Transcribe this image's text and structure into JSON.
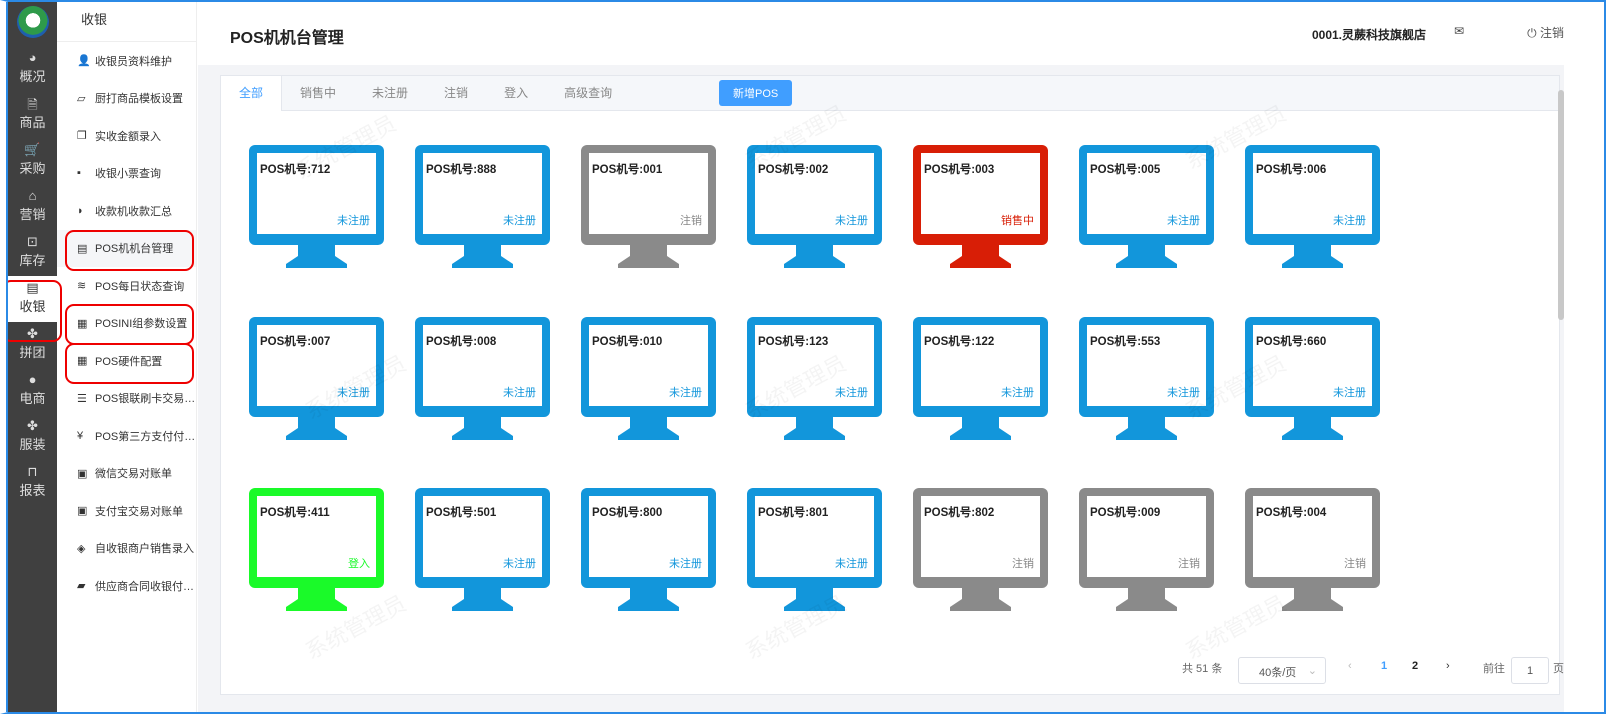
{
  "nav": [
    {
      "label": "概况",
      "icon": "dashboard-icon"
    },
    {
      "label": "商品",
      "icon": "document-icon"
    },
    {
      "label": "采购",
      "icon": "cart-icon"
    },
    {
      "label": "营销",
      "icon": "tag-icon"
    },
    {
      "label": "库存",
      "icon": "box-icon"
    },
    {
      "label": "收银",
      "icon": "cash-register-icon",
      "active": true
    },
    {
      "label": "拼团",
      "icon": "clover-icon"
    },
    {
      "label": "电商",
      "icon": "user-icon"
    },
    {
      "label": "服装",
      "icon": "clover-icon"
    },
    {
      "label": "报表",
      "icon": "report-icon"
    }
  ],
  "submenu": {
    "title": "收银",
    "items": [
      {
        "label": "收银员资料维护"
      },
      {
        "label": "厨打商品模板设置"
      },
      {
        "label": "实收金额录入"
      },
      {
        "label": "收银小票查询"
      },
      {
        "label": "收款机收款汇总"
      },
      {
        "label": "POS机机台管理",
        "active": true
      },
      {
        "label": "POS每日状态查询"
      },
      {
        "label": "POSINI组参数设置"
      },
      {
        "label": "POS硬件配置"
      },
      {
        "label": "POS银联刷卡交易…"
      },
      {
        "label": "POS第三方支付付…"
      },
      {
        "label": "微信交易对账单"
      },
      {
        "label": "支付宝交易对账单"
      },
      {
        "label": "自收银商户销售录入"
      },
      {
        "label": "供应商合同收银付…"
      }
    ]
  },
  "header": {
    "title": "POS机机台管理",
    "store": "0001.灵蕨科技旗舰店",
    "logout": "注销"
  },
  "tabs": [
    "全部",
    "销售中",
    "未注册",
    "注销",
    "登入",
    "高级查询"
  ],
  "new_button": "新增POS",
  "watermark": "系统管理员",
  "status_colors": {
    "未注册": "#1296db",
    "注销": "#8a8a8a",
    "销售中": "#d81e06",
    "登入": "#1afa29"
  },
  "status_text_colors": {
    "未注册": "#1296db",
    "注销": "#888888",
    "销售中": "#d81e06",
    "登入": "#1afa29"
  },
  "pos_list": [
    {
      "name": "POS机号:712",
      "status": "未注册"
    },
    {
      "name": "POS机号:888",
      "status": "未注册"
    },
    {
      "name": "POS机号:001",
      "status": "注销"
    },
    {
      "name": "POS机号:002",
      "status": "未注册"
    },
    {
      "name": "POS机号:003",
      "status": "销售中"
    },
    {
      "name": "POS机号:005",
      "status": "未注册"
    },
    {
      "name": "POS机号:006",
      "status": "未注册"
    },
    {
      "name": "POS机号:007",
      "status": "未注册"
    },
    {
      "name": "POS机号:008",
      "status": "未注册"
    },
    {
      "name": "POS机号:010",
      "status": "未注册"
    },
    {
      "name": "POS机号:123",
      "status": "未注册"
    },
    {
      "name": "POS机号:122",
      "status": "未注册"
    },
    {
      "name": "POS机号:553",
      "status": "未注册"
    },
    {
      "name": "POS机号:660",
      "status": "未注册"
    },
    {
      "name": "POS机号:411",
      "status": "登入"
    },
    {
      "name": "POS机号:501",
      "status": "未注册"
    },
    {
      "name": "POS机号:800",
      "status": "未注册"
    },
    {
      "name": "POS机号:801",
      "status": "未注册"
    },
    {
      "name": "POS机号:802",
      "status": "注销"
    },
    {
      "name": "POS机号:009",
      "status": "注销"
    },
    {
      "name": "POS机号:004",
      "status": "注销"
    }
  ],
  "pagination": {
    "total": "共 51 条",
    "page_size": "40条/页",
    "pages": [
      "1",
      "2"
    ],
    "current": "1",
    "goto_label": "前往",
    "goto_value": "1",
    "page_suffix": "页"
  }
}
